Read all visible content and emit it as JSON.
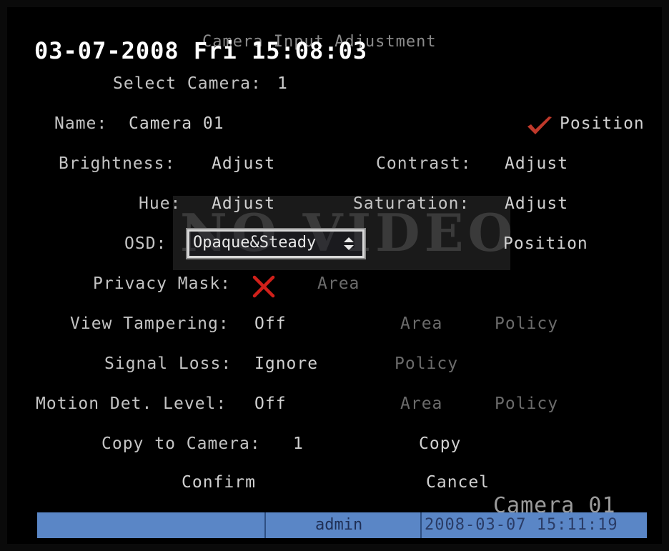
{
  "header": {
    "title": "Camera Input Adjustment",
    "datetime": "03-07-2008 Fri 15:08:03"
  },
  "select_camera": {
    "label": "Select Camera:",
    "value": "1"
  },
  "name": {
    "label": "Name:",
    "value": "Camera 01",
    "position_label": "Position",
    "position_checked": true
  },
  "brightness": {
    "label": "Brightness:",
    "button": "Adjust"
  },
  "contrast": {
    "label": "Contrast:",
    "button": "Adjust"
  },
  "hue": {
    "label": "Hue:",
    "button": "Adjust"
  },
  "saturation": {
    "label": "Saturation:",
    "button": "Adjust"
  },
  "osd": {
    "label": "OSD:",
    "value": "Opaque&Steady",
    "position_label": "Position"
  },
  "privacy_mask": {
    "label": "Privacy Mask:",
    "checked": false,
    "area": "Area"
  },
  "view_tampering": {
    "label": "View Tampering:",
    "value": "Off",
    "area": "Area",
    "policy": "Policy"
  },
  "signal_loss": {
    "label": "Signal Loss:",
    "value": "Ignore",
    "policy": "Policy"
  },
  "motion_detection": {
    "label": "Motion Det. Level:",
    "value": "Off",
    "area": "Area",
    "policy": "Policy"
  },
  "copy": {
    "label": "Copy to Camera:",
    "value": "1",
    "button": "Copy"
  },
  "actions": {
    "confirm": "Confirm",
    "cancel": "Cancel"
  },
  "overlay": {
    "no_video": "NO VIDEO",
    "camera_name": "Camera 01"
  },
  "status_bar": {
    "user": "admin",
    "datetime": "2008-03-07 15:11:19"
  },
  "colors": {
    "status_bar": "#5a86c6",
    "check": "#c0392b",
    "cross": "#d0201a",
    "background": "#000000"
  }
}
